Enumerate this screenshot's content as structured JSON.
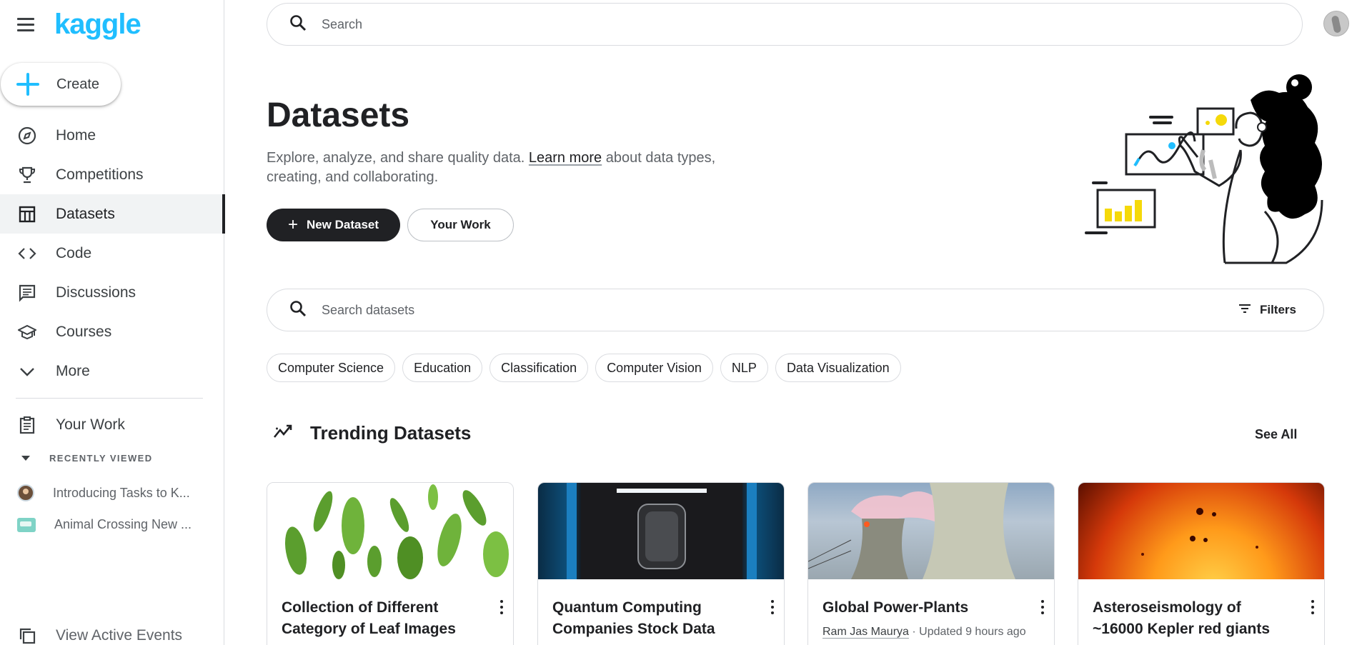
{
  "brand": {
    "logo": "kaggle"
  },
  "sidebar": {
    "create_label": "Create",
    "items": [
      {
        "label": "Home",
        "icon": "compass-icon"
      },
      {
        "label": "Competitions",
        "icon": "trophy-icon"
      },
      {
        "label": "Datasets",
        "icon": "table-icon",
        "active": true
      },
      {
        "label": "Code",
        "icon": "code-icon"
      },
      {
        "label": "Discussions",
        "icon": "comment-icon"
      },
      {
        "label": "Courses",
        "icon": "school-icon"
      },
      {
        "label": "More",
        "icon": "chevron-down-icon"
      }
    ],
    "your_work": "Your Work",
    "recently_viewed_title": "RECENTLY VIEWED",
    "recent": [
      {
        "label": "Introducing Tasks to K..."
      },
      {
        "label": "Animal Crossing New ..."
      }
    ],
    "view_active_events": "View Active Events"
  },
  "topbar": {
    "search_placeholder": "Search"
  },
  "hero": {
    "title": "Datasets",
    "desc_before": "Explore, analyze, and share quality data. ",
    "desc_link": "Learn more",
    "desc_after": " about data types, creating, and collaborating.",
    "new_dataset": "New Dataset",
    "your_work": "Your Work"
  },
  "dataset_search": {
    "placeholder": "Search datasets",
    "filters_label": "Filters"
  },
  "chips": [
    "Computer Science",
    "Education",
    "Classification",
    "Computer Vision",
    "NLP",
    "Data Visualization"
  ],
  "trending": {
    "title": "Trending Datasets",
    "see_all": "See All",
    "cards": [
      {
        "title": "Collection of Different Category of Leaf Images",
        "author": "",
        "updated": ""
      },
      {
        "title": "Quantum Computing Companies Stock Data",
        "author": "",
        "updated": ""
      },
      {
        "title": "Global Power-Plants",
        "author": "Ram Jas Maurya",
        "updated": " · Updated 9 hours ago"
      },
      {
        "title": "Asteroseismology of ~16000 Kepler red giants",
        "author": "",
        "updated": ""
      }
    ]
  },
  "colors": {
    "brand": "#20beff",
    "text": "#202124",
    "muted": "#5f6368",
    "border": "#dadce0",
    "active_bg": "#f1f3f4"
  }
}
